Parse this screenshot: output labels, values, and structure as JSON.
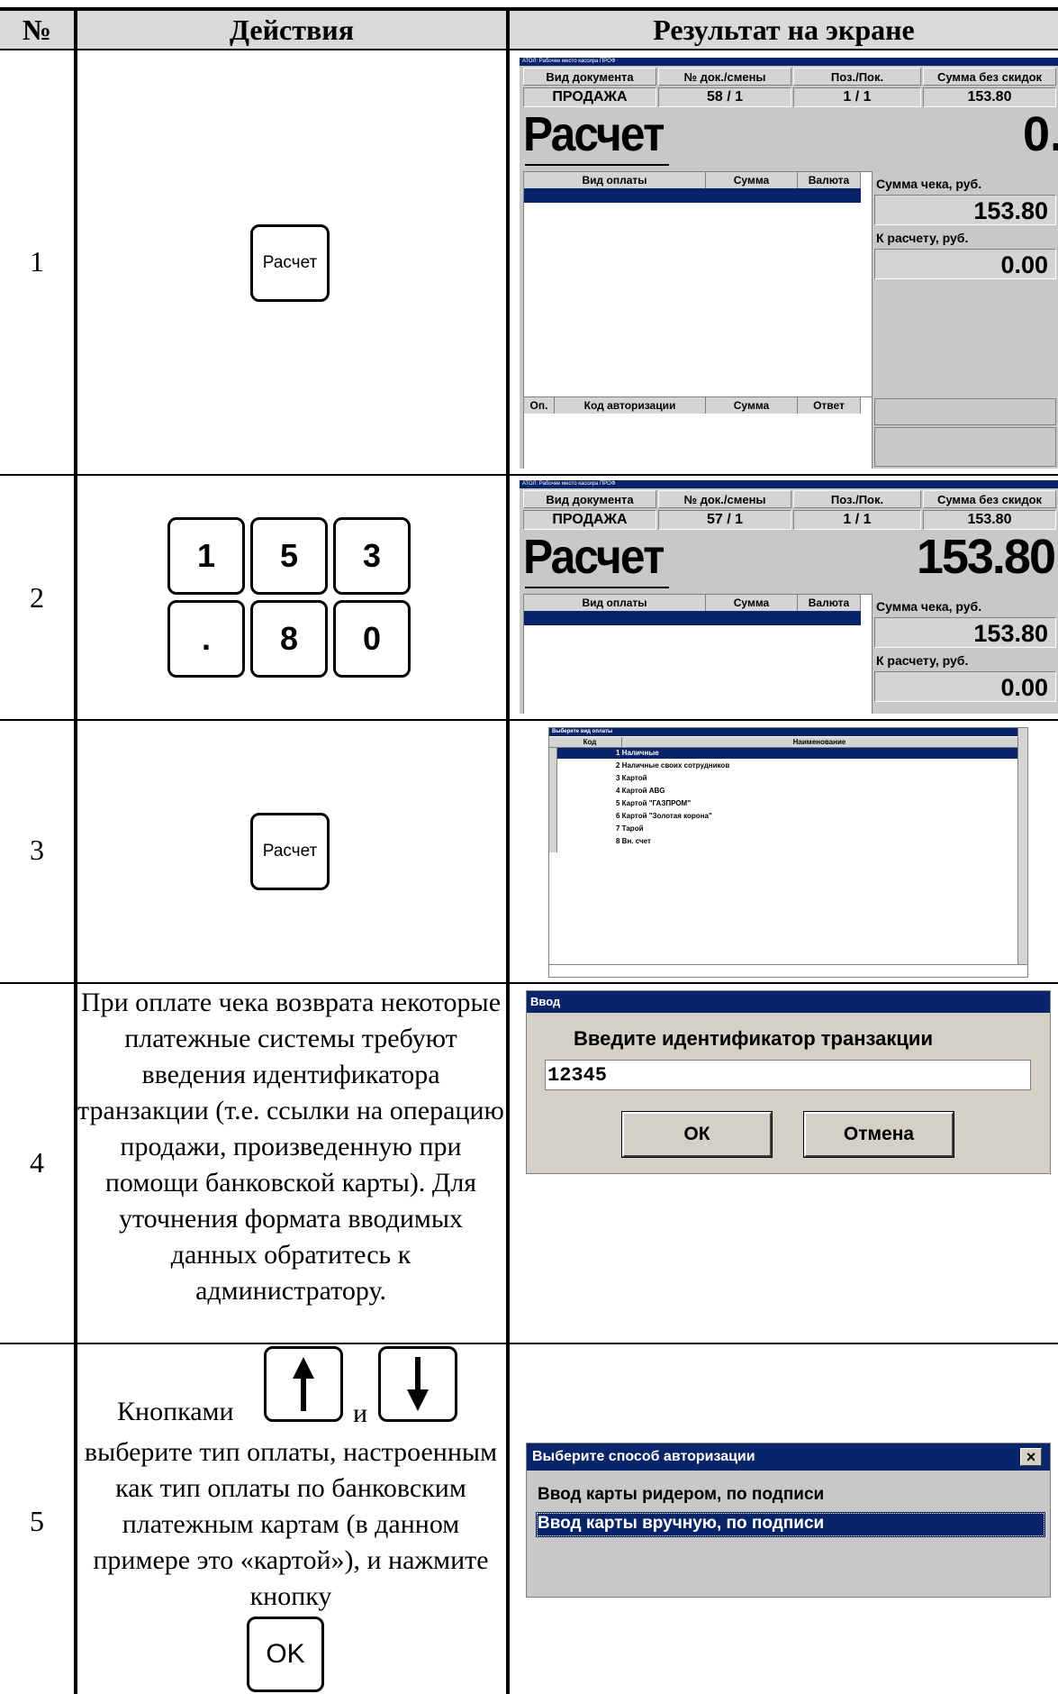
{
  "table": {
    "headers": {
      "num": "№",
      "actions": "Действия",
      "result": "Результат на экране"
    },
    "rows": [
      {
        "num": "1"
      },
      {
        "num": "2"
      },
      {
        "num": "3"
      },
      {
        "num": "4"
      },
      {
        "num": "5"
      }
    ]
  },
  "row1": {
    "key": "Расчет"
  },
  "row2": {
    "keys": [
      "1",
      "5",
      "3",
      ".",
      "8",
      "0"
    ]
  },
  "row3": {
    "key": "Расчет"
  },
  "row4": {
    "text": "При оплате чека возврата некоторые платежные системы требуют введения идентификатора транзакции (т.е. ссылки на операцию продажи, произведенную при помощи банковской карты). Для уточнения формата вводимых данных обратитесь к администратору."
  },
  "row5": {
    "text_before": "Кнопками",
    "text_and": "и",
    "text_after": "выберите тип оплаты, настроенным как тип оплаты по банковским платежным картам (в данном примере это «картой»), и нажмите кнопку",
    "key": "OK"
  },
  "screen1": {
    "titlebar": "АТОЛ: Рабочее место кассира ПРОФ",
    "headers": [
      "Вид документа",
      "№ док./смены",
      "Поз./Пок.",
      "Сумма без скидок"
    ],
    "values": [
      "ПРОДАЖА",
      "58 / 1",
      "1 / 1",
      "153.80"
    ],
    "mode": "Расчет",
    "amount": "0.",
    "pay_cols": [
      "Вид оплаты",
      "Сумма",
      "Валюта"
    ],
    "auth_cols": [
      "Оп.",
      "Код авторизации",
      "Сумма",
      "Ответ"
    ],
    "check_label": "Сумма чека, руб.",
    "check_value": "153.80",
    "due_label": "К расчету, руб.",
    "due_value": "0.00"
  },
  "screen2": {
    "titlebar": "АТОЛ: Рабочее место кассира ПРОФ",
    "headers": [
      "Вид документа",
      "№ док./смены",
      "Поз./Пок.",
      "Сумма без скидок"
    ],
    "values": [
      "ПРОДАЖА",
      "57 / 1",
      "1 / 1",
      "153.80"
    ],
    "mode": "Расчет",
    "amount": "153.80",
    "pay_cols": [
      "Вид оплаты",
      "Сумма",
      "Валюта"
    ],
    "check_label": "Сумма чека, руб.",
    "check_value": "153.80",
    "due_label": "К расчету, руб.",
    "due_value": "0.00"
  },
  "screen3": {
    "titlebar": "Выберите вид оплаты",
    "cols": [
      "Код",
      "Наименование"
    ],
    "items": [
      "1 Наличные",
      "2 Наличные своих сотрудников",
      "3 Картой",
      "4 Картой ABG",
      "5 Картой \"ГАЗПРОМ\"",
      "6 Картой \"Золотая корона\"",
      "7 Тарой",
      "8 Вн. счет"
    ]
  },
  "screen4": {
    "title": "Ввод",
    "prompt": "Введите идентификатор транзакции",
    "value": "12345",
    "ok": "ОК",
    "cancel": "Отмена"
  },
  "screen5": {
    "title": "Выберите способ авторизации",
    "close": "×",
    "items": [
      "Ввод карты ридером, по подписи",
      "Ввод карты вручную, по подписи"
    ],
    "selected_index": 1
  }
}
